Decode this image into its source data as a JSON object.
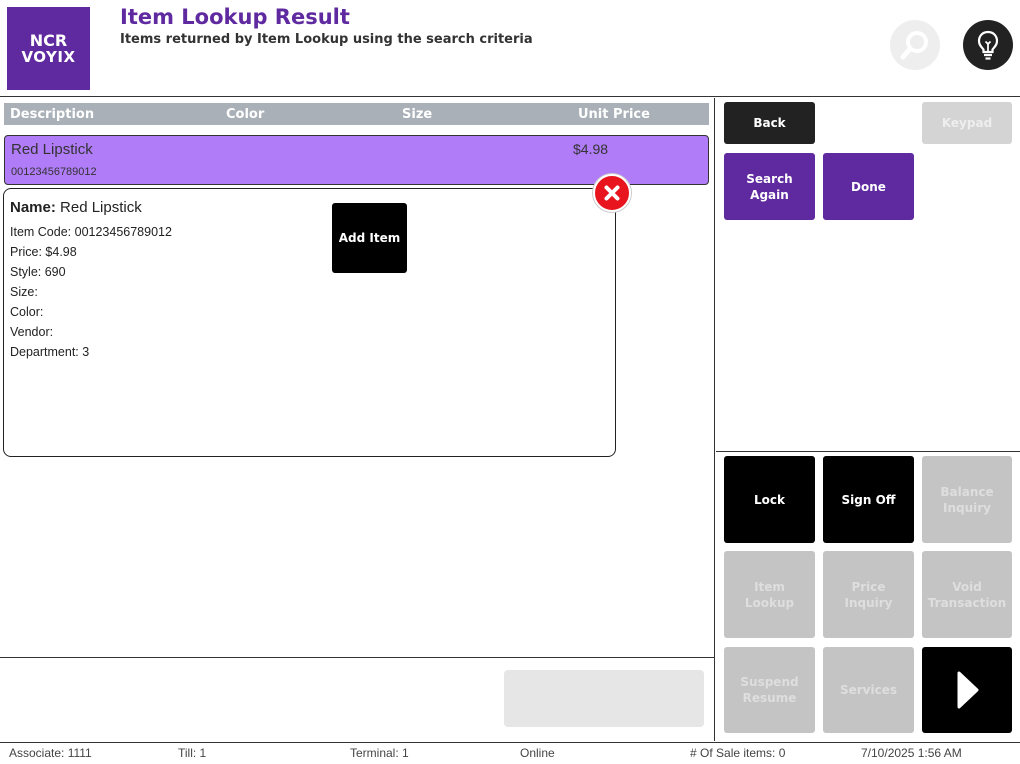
{
  "header": {
    "logo_line1": "NCR",
    "logo_line2": "VOYIX",
    "title": "Item Lookup Result",
    "subtitle": "Items returned by Item Lookup using the search criteria"
  },
  "grid": {
    "columns": [
      "Description",
      "Color",
      "Size",
      "Unit Price"
    ],
    "selected_row": {
      "description": "Red Lipstick",
      "code": "00123456789012",
      "price": "$4.98"
    }
  },
  "detail": {
    "name_label": "Name:",
    "name_value": "Red Lipstick",
    "lines": [
      "Item Code: 00123456789012",
      "Price: $4.98",
      "Style: 690",
      "Size:",
      "Color:",
      "Vendor:",
      "Department: 3"
    ],
    "add_item_label": "Add Item"
  },
  "actions_top": {
    "back": "Back",
    "keypad": "Keypad",
    "search_again": "Search Again",
    "done": "Done"
  },
  "actions_bottom": {
    "lock": "Lock",
    "sign_off": "Sign Off",
    "balance_inquiry": "Balance Inquiry",
    "item_lookup": "Item Lookup",
    "price_inquiry": "Price Inquiry",
    "void_transaction": "Void Transaction",
    "suspend_resume": "Suspend Resume",
    "services": "Services"
  },
  "status": {
    "associate": "Associate: 1111",
    "till": "Till: 1",
    "terminal": "Terminal: 1",
    "online": "Online",
    "sale_items": "# Of Sale items: 0",
    "datetime": "7/10/2025 1:56 AM"
  },
  "colors": {
    "brand_purple": "#5f2aa0",
    "selected_row": "#b07cf8",
    "close_red": "#e8141e"
  },
  "icons": [
    "search-icon",
    "lightbulb-icon",
    "close-icon",
    "arrow-right-icon"
  ]
}
